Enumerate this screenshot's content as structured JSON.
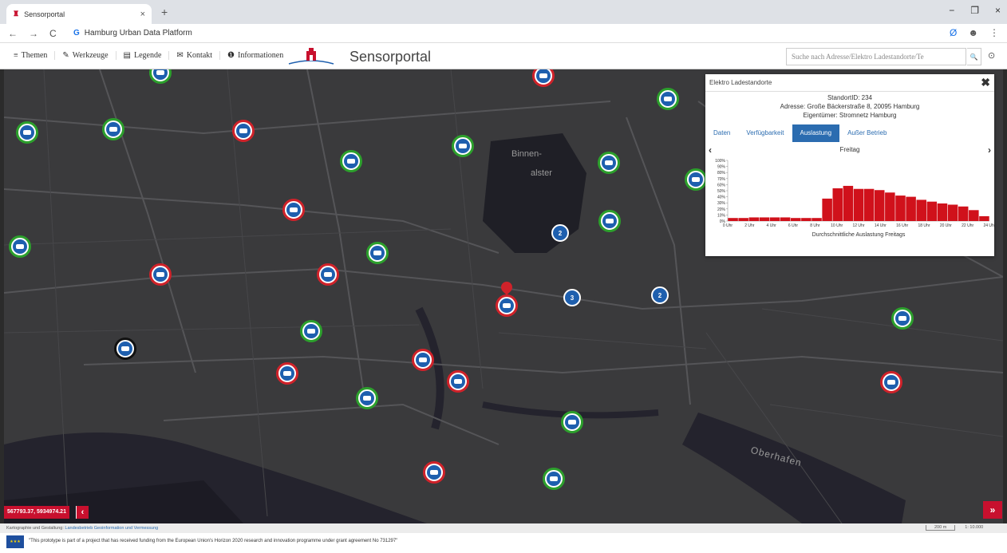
{
  "browser": {
    "tab_title": "Sensorportal",
    "tab_close": "×",
    "new_tab": "+",
    "back": "←",
    "forward": "→",
    "reload": "C",
    "url_icon": "G",
    "url": "Hamburg Urban Data Platform",
    "window_controls": [
      "−",
      "❐",
      "×"
    ],
    "ext_icon": "Ø",
    "profile_icon": "☻",
    "menu_icon": "⋮"
  },
  "app": {
    "menu": [
      {
        "label": "Themen",
        "icon": "≡"
      },
      {
        "label": "Werkzeuge",
        "icon": "✎"
      },
      {
        "label": "Legende",
        "icon": "▤"
      },
      {
        "label": "Kontakt",
        "icon": "✉"
      },
      {
        "label": "Informationen",
        "icon": "❶"
      }
    ],
    "title": "Sensorportal",
    "search_placeholder": "Suche nach Adresse/Elektro Ladestandorte/Te",
    "search_icon": "🔍",
    "help_icon": "⊙"
  },
  "map": {
    "labels": [
      "Binnen-",
      "alster",
      "Oberhafen"
    ],
    "cluster_labels": [
      "2",
      "3",
      "2"
    ]
  },
  "popup": {
    "title": "Elektro Ladestandorte",
    "close": "✖",
    "standort": "StandortID: 234",
    "adresse": "Adresse: Große Bäckerstraße 8, 20095 Hamburg",
    "eigentuemer": "Eigentümer: Stromnetz Hamburg",
    "tabs": [
      "Daten",
      "Verfügbarkeit",
      "Auslastung",
      "Außer Betrieb"
    ],
    "active_tab": 2,
    "day": "Freitag",
    "prev": "‹",
    "next": "›"
  },
  "chart_data": {
    "type": "bar",
    "title": "",
    "xlabel": "Durchschnittliche Auslastung Freitags",
    "ylabel": "",
    "ylim": [
      0,
      100
    ],
    "y_ticks": [
      "100%",
      "90%",
      "80%",
      "70%",
      "60%",
      "50%",
      "40%",
      "30%",
      "20%",
      "10%",
      "0%"
    ],
    "x_ticks": [
      "0 Uhr",
      "2 Uhr",
      "4 Uhr",
      "6 Uhr",
      "8 Uhr",
      "10 Uhr",
      "12 Uhr",
      "14 Uhr",
      "16 Uhr",
      "18 Uhr",
      "20 Uhr",
      "22 Uhr",
      "24 Uhr"
    ],
    "values": [
      5,
      5,
      6,
      6,
      6,
      6,
      5,
      5,
      5,
      37,
      54,
      58,
      53,
      53,
      51,
      47,
      42,
      40,
      35,
      32,
      29,
      27,
      24,
      18,
      8
    ],
    "color": "#d0111b"
  },
  "status": {
    "coords": "567793.37, 5934974.21",
    "coords_btn": "‹",
    "ff_btn": "»",
    "attribution": "Kartographie und Gestaltung:",
    "attribution_link": "Landesbetrieb Geoinformation und Vermessung",
    "scale_bar": "200 m",
    "scale_ratio": "1: 10.000"
  },
  "footer": {
    "text": "\"This prototype is part of a project that has received funding from the European Union's Horizon 2020 research and innovation programme under grant agreement No 731297\""
  }
}
